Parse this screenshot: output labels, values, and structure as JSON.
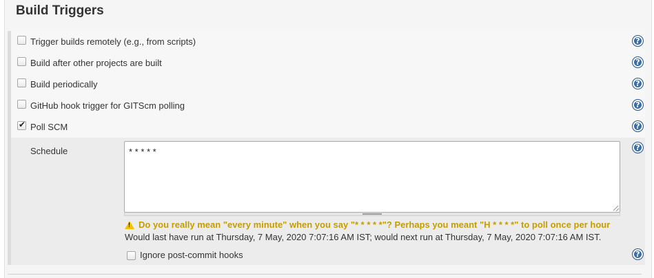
{
  "section": {
    "title": "Build Triggers"
  },
  "triggers": [
    {
      "label": "Trigger builds remotely (e.g., from scripts)",
      "checked": false
    },
    {
      "label": "Build after other projects are built",
      "checked": false
    },
    {
      "label": "Build periodically",
      "checked": false
    },
    {
      "label": "GitHub hook trigger for GITScm polling",
      "checked": false
    },
    {
      "label": "Poll SCM",
      "checked": true
    }
  ],
  "poll_scm": {
    "schedule_label": "Schedule",
    "schedule_value": "* * * * *",
    "warning": "Do you really mean \"every minute\" when you say \"* * * * *\"? Perhaps you meant \"H * * * *\" to poll once per hour",
    "run_info": "Would last have run at Thursday, 7 May, 2020 7:07:16 AM IST; would next run at Thursday, 7 May, 2020 7:07:16 AM IST.",
    "ignore_hooks_label": "Ignore post-commit hooks",
    "ignore_hooks_checked": false
  },
  "icons": {
    "help": "help-icon",
    "warning": "warning-icon"
  },
  "colors": {
    "help_blue": "#3a6ea5",
    "warning_text": "#c59d00",
    "warning_icon": "#f2c200"
  }
}
